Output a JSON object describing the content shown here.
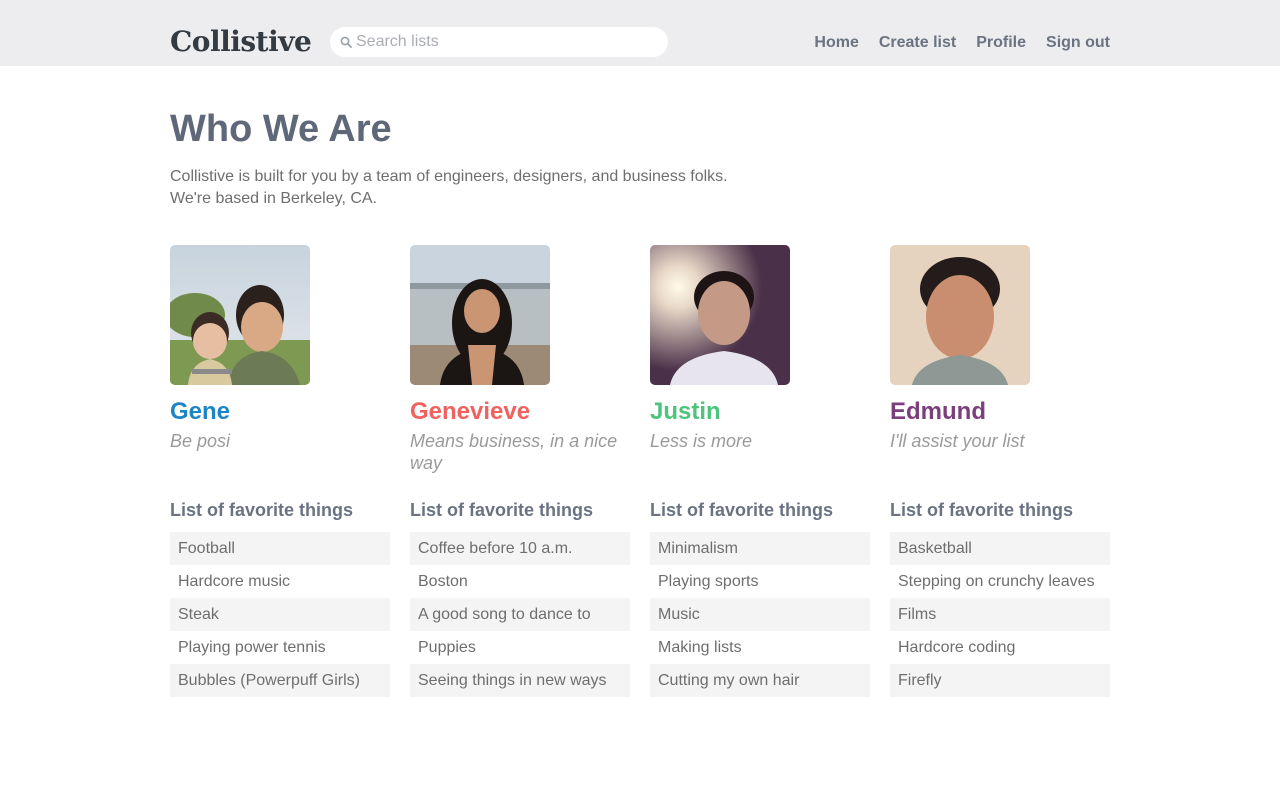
{
  "header": {
    "logo": "Collistive",
    "search_placeholder": "Search lists",
    "nav": [
      "Home",
      "Create list",
      "Profile",
      "Sign out"
    ]
  },
  "main": {
    "title": "Who We Are",
    "intro": [
      "Collistive is built for you by a team of engineers, designers, and business folks.",
      "We're based in Berkeley, CA."
    ],
    "list_heading": "List of favorite things",
    "team": [
      {
        "name": "Gene",
        "color": "#1e85c4",
        "motto": "Be posi",
        "favorites": [
          "Football",
          "Hardcore music",
          "Steak",
          "Playing power tennis",
          "Bubbles (Powerpuff Girls)"
        ]
      },
      {
        "name": "Genevieve",
        "color": "#f1625f",
        "motto": "Means business, in a nice way",
        "favorites": [
          "Coffee before 10 a.m.",
          "Boston",
          "A good song to dance to",
          "Puppies",
          "Seeing things in new ways"
        ]
      },
      {
        "name": "Justin",
        "color": "#4dc47c",
        "motto": "Less is more",
        "favorites": [
          "Minimalism",
          "Playing sports",
          "Music",
          "Making lists",
          "Cutting my own hair"
        ]
      },
      {
        "name": "Edmund",
        "color": "#7b3f7e",
        "motto": "I'll assist your list",
        "favorites": [
          "Basketball",
          "Stepping on crunchy leaves",
          "Films",
          "Hardcore coding",
          "Firefly"
        ]
      }
    ]
  }
}
